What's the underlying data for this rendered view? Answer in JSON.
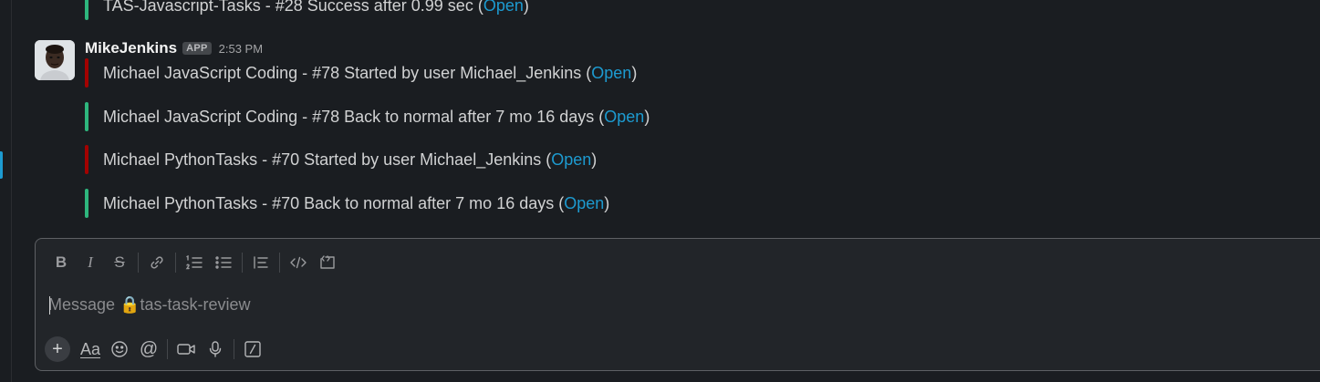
{
  "messages": {
    "previous": {
      "text": "TAS-Javascript-Tasks - #28 Success after 0.99 sec (",
      "link": "Open",
      "close": ")",
      "bar_color": "#2eb67d"
    },
    "group": {
      "username": "MikeJenkins",
      "badge": "APP",
      "time": "2:53 PM",
      "lines": [
        {
          "text": "Michael JavaScript Coding - #78 Started by user Michael_Jenkins (",
          "link": "Open",
          "close": ")",
          "bar_color": "#a30200"
        },
        {
          "text": "Michael JavaScript Coding - #78 Back to normal after 7 mo 16 days (",
          "link": "Open",
          "close": ")",
          "bar_color": "#2eb67d"
        },
        {
          "text": "Michael PythonTasks - #70 Started by user Michael_Jenkins (",
          "link": "Open",
          "close": ")",
          "bar_color": "#a30200"
        },
        {
          "text": "Michael PythonTasks - #70 Back to normal after 7 mo 16 days (",
          "link": "Open",
          "close": ")",
          "bar_color": "#2eb67d"
        }
      ]
    }
  },
  "composer": {
    "placeholder": "Message 🔒tas-task-review",
    "value": ""
  },
  "colors": {
    "background": "#1a1d21",
    "link": "#1d9bd1",
    "success": "#2eb67d",
    "started": "#a30200"
  }
}
